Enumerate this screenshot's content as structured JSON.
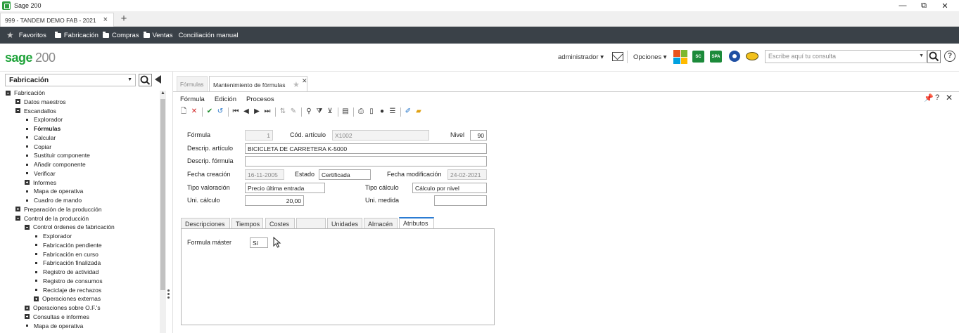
{
  "window": {
    "title": "Sage 200",
    "controls": [
      "—",
      "⧉",
      "✕"
    ]
  },
  "browser_tab": {
    "label": "999 - TANDEM DEMO FAB - 2021",
    "close": "×",
    "new_tab": "+"
  },
  "navbar": {
    "favorites": "Favoritos",
    "items": [
      "Fabricación",
      "Compras",
      "Ventas"
    ],
    "extra": "Conciliación manual"
  },
  "header": {
    "brand": "sage",
    "version": "200",
    "user": "administrador ▾",
    "options": "Opciones ▾",
    "badges": [
      "SC",
      "SPA"
    ],
    "search_placeholder": "Escribe aquí tu consulta",
    "help": "?"
  },
  "sidebar": {
    "module": "Fabricación",
    "tree": [
      {
        "label": "Fabricación",
        "level": 0,
        "icon": "minus"
      },
      {
        "label": "Datos maestros",
        "level": 1,
        "icon": "plus"
      },
      {
        "label": "Escandallos",
        "level": 1,
        "icon": "minus"
      },
      {
        "label": "Explorador",
        "level": 2,
        "icon": "bullet"
      },
      {
        "label": "Fórmulas",
        "level": 2,
        "icon": "bullet",
        "active": true
      },
      {
        "label": "Calcular",
        "level": 2,
        "icon": "bullet"
      },
      {
        "label": "Copiar",
        "level": 2,
        "icon": "bullet"
      },
      {
        "label": "Sustituir componente",
        "level": 2,
        "icon": "bullet"
      },
      {
        "label": "Añadir componente",
        "level": 2,
        "icon": "bullet"
      },
      {
        "label": "Verificar",
        "level": 2,
        "icon": "bullet"
      },
      {
        "label": "Informes",
        "level": 2,
        "icon": "plus"
      },
      {
        "label": "Mapa de operativa",
        "level": 2,
        "icon": "bullet"
      },
      {
        "label": "Cuadro de mando",
        "level": 2,
        "icon": "bullet"
      },
      {
        "label": "Preparación de la producción",
        "level": 1,
        "icon": "plus"
      },
      {
        "label": "Control de la producción",
        "level": 1,
        "icon": "minus"
      },
      {
        "label": "Control órdenes de fabricación",
        "level": 2,
        "icon": "minus"
      },
      {
        "label": "Explorador",
        "level": 3,
        "icon": "bullet"
      },
      {
        "label": "Fabricación pendiente",
        "level": 3,
        "icon": "bullet"
      },
      {
        "label": "Fabricación en curso",
        "level": 3,
        "icon": "bullet"
      },
      {
        "label": "Fabricación finalizada",
        "level": 3,
        "icon": "bullet"
      },
      {
        "label": "Registro de actividad",
        "level": 3,
        "icon": "bullet"
      },
      {
        "label": "Registro de consumos",
        "level": 3,
        "icon": "bullet"
      },
      {
        "label": "Reciclaje de rechazos",
        "level": 3,
        "icon": "bullet"
      },
      {
        "label": "Operaciones externas",
        "level": 3,
        "icon": "plus"
      },
      {
        "label": "Operaciones sobre O.F.'s",
        "level": 2,
        "icon": "plus"
      },
      {
        "label": "Consultas e informes",
        "level": 2,
        "icon": "plus"
      },
      {
        "label": "Mapa de operativa",
        "level": 2,
        "icon": "bullet"
      }
    ]
  },
  "main": {
    "tabs": [
      {
        "label": "Fórmulas"
      },
      {
        "label": "Mantenimiento de fórmulas"
      }
    ],
    "menu": [
      "Fórmula",
      "Edición",
      "Procesos"
    ],
    "form": {
      "formula_label": "Fórmula",
      "formula_value": "1",
      "cod_articulo_label": "Cód. artículo",
      "cod_articulo_value": "X1002",
      "nivel_label": "Nivel",
      "nivel_value": "90",
      "descrip_articulo_label": "Descrip. artículo",
      "descrip_articulo_value": "BICICLETA DE CARRETERA K-5000",
      "descrip_formula_label": "Descrip. fórmula",
      "descrip_formula_value": "",
      "fecha_creacion_label": "Fecha creación",
      "fecha_creacion_value": "16-11-2005",
      "estado_label": "Estado",
      "estado_value": "Certificada",
      "fecha_modificacion_label": "Fecha modificación",
      "fecha_modificacion_value": "24-02-2021",
      "tipo_valoracion_label": "Tipo valoración",
      "tipo_valoracion_value": "Precio última entrada",
      "tipo_calculo_label": "Tipo cálculo",
      "tipo_calculo_value": "Cálculo por nivel",
      "uni_calculo_label": "Uni. cálculo",
      "uni_calculo_value": "20,00",
      "uni_medida_label": "Uni. medida",
      "uni_medida_value": ""
    },
    "subtabs": [
      "Descripciones",
      "Tiempos",
      "Costes",
      "",
      "Unidades",
      "Almacén",
      "Atributos"
    ],
    "active_subtab": "Atributos",
    "attributes": {
      "formula_master_label": "Formula máster",
      "formula_master_value": "Sí"
    }
  }
}
